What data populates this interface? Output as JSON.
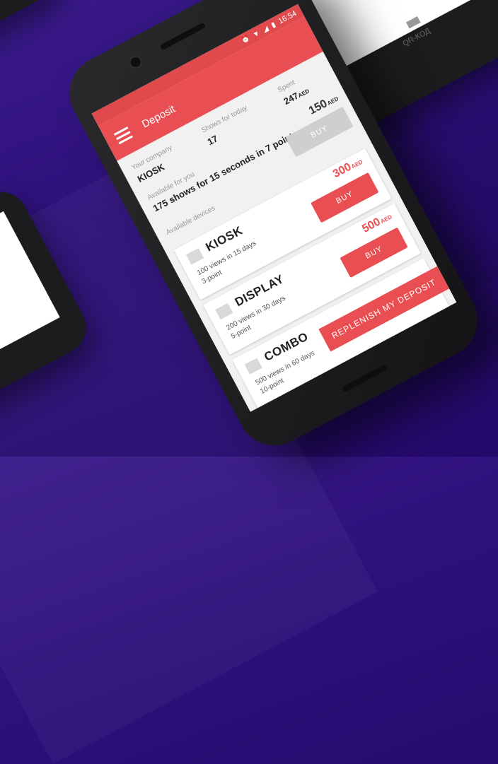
{
  "status_bar": {
    "time": "16:54"
  },
  "app_bar": {
    "title": "Deposit"
  },
  "info": {
    "company_label": "Your company",
    "company_value": "KIOSK",
    "shows_label": "Shows for today",
    "shows_value": "17",
    "spent_label": "Spent",
    "spent_value": "247",
    "spent_unit": "AED",
    "available_label": "Available for you",
    "available_value": "175 shows for 15 seconds in 7 points",
    "devices_label": "Available devices"
  },
  "top_offer": {
    "price": "150",
    "unit": "AED",
    "buy_label": "BUY",
    "buy_color": "#cfcfcf"
  },
  "packages": [
    {
      "name": "KIOSK",
      "views": "100 views in 15 days",
      "points": "3-point",
      "price": "300",
      "unit": "AED",
      "buy_label": "BUY"
    },
    {
      "name": "DISPLAY",
      "views": "200 views in 30 days",
      "points": "5-point",
      "price": "500",
      "unit": "AED",
      "buy_label": "BUY"
    },
    {
      "name": "COMBO",
      "views": "500 views in 60 days",
      "points": "10-point"
    }
  ],
  "replenish_label": "REPLENISH MY DEPOSIT",
  "background_phone": {
    "qr_label": "QR-КОД"
  },
  "colors": {
    "accent": "#e94f52",
    "status_bar": "#e04a4d",
    "background": "#2c0f78"
  }
}
